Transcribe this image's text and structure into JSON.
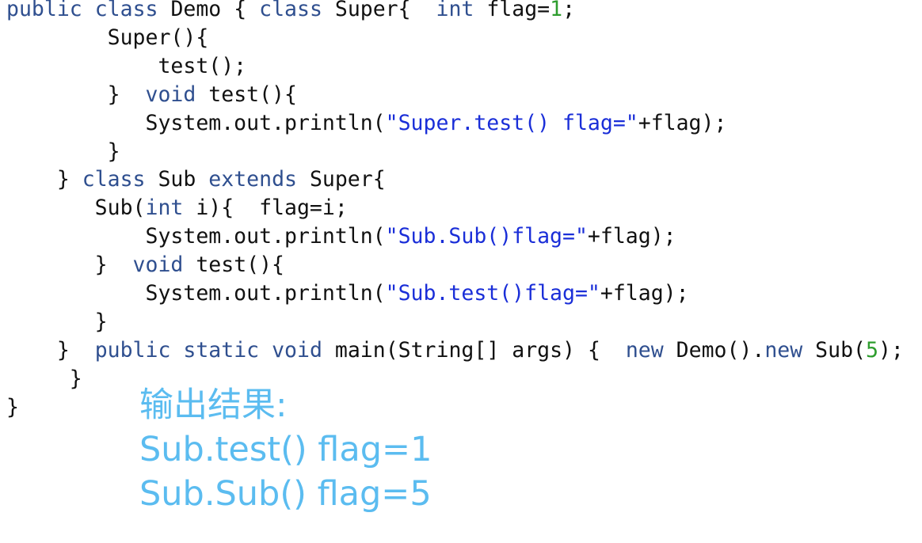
{
  "code": {
    "lines": [
      [
        {
          "t": "public",
          "k": "kw"
        },
        {
          "t": " ",
          "k": "plain"
        },
        {
          "t": "class",
          "k": "kw"
        },
        {
          "t": " Demo { ",
          "k": "plain"
        },
        {
          "t": "class",
          "k": "kw"
        },
        {
          "t": " Super{  ",
          "k": "plain"
        },
        {
          "t": "int",
          "k": "kw"
        },
        {
          "t": " flag=",
          "k": "plain"
        },
        {
          "t": "1",
          "k": "num"
        },
        {
          "t": ";",
          "k": "plain"
        }
      ],
      [
        {
          "t": "        Super(){",
          "k": "plain"
        }
      ],
      [
        {
          "t": "            test();",
          "k": "plain"
        }
      ],
      [
        {
          "t": "        }  ",
          "k": "plain"
        },
        {
          "t": "void",
          "k": "kw"
        },
        {
          "t": " test(){",
          "k": "plain"
        }
      ],
      [
        {
          "t": "           System.out.println(",
          "k": "plain"
        },
        {
          "t": "\"Super.test() flag=\"",
          "k": "str"
        },
        {
          "t": "+flag);",
          "k": "plain"
        }
      ],
      [
        {
          "t": "        }",
          "k": "plain"
        }
      ],
      [
        {
          "t": "    } ",
          "k": "plain"
        },
        {
          "t": "class",
          "k": "kw"
        },
        {
          "t": " Sub ",
          "k": "plain"
        },
        {
          "t": "extends",
          "k": "kw"
        },
        {
          "t": " Super{",
          "k": "plain"
        }
      ],
      [
        {
          "t": "       Sub(",
          "k": "plain"
        },
        {
          "t": "int",
          "k": "kw"
        },
        {
          "t": " i){  flag=i;",
          "k": "plain"
        }
      ],
      [
        {
          "t": "           System.out.println(",
          "k": "plain"
        },
        {
          "t": "\"Sub.Sub()flag=\"",
          "k": "str"
        },
        {
          "t": "+flag);",
          "k": "plain"
        }
      ],
      [
        {
          "t": "       }  ",
          "k": "plain"
        },
        {
          "t": "void",
          "k": "kw"
        },
        {
          "t": " test(){",
          "k": "plain"
        }
      ],
      [
        {
          "t": "           System.out.println(",
          "k": "plain"
        },
        {
          "t": "\"Sub.test()flag=\"",
          "k": "str"
        },
        {
          "t": "+flag);",
          "k": "plain"
        }
      ],
      [
        {
          "t": "       }",
          "k": "plain"
        }
      ],
      [
        {
          "t": "    }  ",
          "k": "plain"
        },
        {
          "t": "public",
          "k": "kw"
        },
        {
          "t": " ",
          "k": "plain"
        },
        {
          "t": "static",
          "k": "kw"
        },
        {
          "t": " ",
          "k": "plain"
        },
        {
          "t": "void",
          "k": "kw"
        },
        {
          "t": " main(String[] args) {  ",
          "k": "plain"
        },
        {
          "t": "new",
          "k": "kw"
        },
        {
          "t": " Demo().",
          "k": "plain"
        },
        {
          "t": "new",
          "k": "kw"
        },
        {
          "t": " Sub(",
          "k": "plain"
        },
        {
          "t": "5",
          "k": "num"
        },
        {
          "t": ");",
          "k": "plain"
        }
      ],
      [
        {
          "t": "     }",
          "k": "plain"
        }
      ],
      [
        {
          "t": "}",
          "k": "plain"
        }
      ]
    ]
  },
  "output": {
    "lines": [
      "输出结果:",
      "Sub.test() flag=1",
      "Sub.Sub() flag=5"
    ]
  },
  "colors": {
    "keyword": "#2f4f8f",
    "string": "#1a2ed8",
    "number": "#2e9d2e",
    "plain": "#111111",
    "output": "#5bbcf0"
  }
}
